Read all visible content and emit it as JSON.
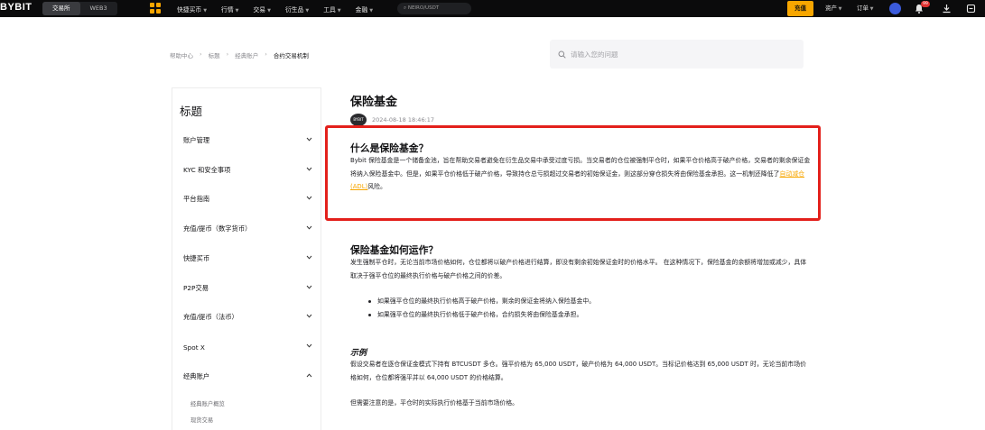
{
  "topnav": {
    "logo": "BYBIT",
    "seg_tabs": [
      "交易所",
      "WEB3"
    ],
    "menu": [
      "快捷买币",
      "行情",
      "交易",
      "衍生品",
      "工具",
      "金融"
    ],
    "search_placeholder": "NEIRO/USDT",
    "deposit_label": "充值",
    "assets_label": "资产",
    "orders_label": "订单",
    "notification_count": "99",
    "accent_color": "#f7a600"
  },
  "breadcrumb": [
    "帮助中心",
    "标题",
    "经典账户",
    "合约交易机制"
  ],
  "help_search": {
    "placeholder": "请输入您的问题"
  },
  "sidebar": {
    "title": "标题",
    "items": [
      {
        "label": "账户管理",
        "expanded": false
      },
      {
        "label": "KYC 和安全事项",
        "expanded": false
      },
      {
        "label": "平台指南",
        "expanded": false
      },
      {
        "label": "充值/提币（数字货币）",
        "expanded": false
      },
      {
        "label": "快捷买币",
        "expanded": false
      },
      {
        "label": "P2P交易",
        "expanded": false
      },
      {
        "label": "充值/提币（法币）",
        "expanded": false
      },
      {
        "label": "Spot X",
        "expanded": false
      },
      {
        "label": "经典账户",
        "expanded": true
      }
    ],
    "sub_items": [
      "经典账户概览",
      "现货交易"
    ]
  },
  "article": {
    "title": "保险基金",
    "author_badge": "BYBIT",
    "date": "2024-08-18 18:46:17",
    "section1": {
      "heading": "什么是保险基金？",
      "text_before_link": "Bybit 保险基金是一个储备金池，旨在帮助交易者避免在衍生品交易中承受过度亏损。当交易者的仓位被强制平仓时，如果平仓价格高于破产价格，交易者的剩余保证金将纳入保险基金中。但是，如果平仓价格低于破产价格，导致持仓总亏损超过交易者的初始保证金，则这部分穿仓损失将由保险基金承担。这一机制还降低了",
      "link_text": "自动减仓 (ADL)",
      "text_after_link": "风险。"
    },
    "section2": {
      "heading": "保险基金如何运作？",
      "text": "发生强制平仓时，无论当前市场价格如何，仓位都将以破产价格进行结算，即没有剩余初始保证金时的价格水平。 在这种情况下，保险基金的余额将增加或减少，具体取决于强平仓位的最终执行价格与破产价格之间的价差。",
      "bullets": [
        "如果强平仓位的最终执行价格高于破产价格，剩余的保证金将纳入保险基金中。",
        "如果强平仓位的最终执行价格低于破产价格，合约损失将由保险基金承担。"
      ]
    },
    "example": {
      "heading": "示例",
      "text": "假设交易者在逐仓保证金模式下持有 BTCUSDT 多仓。强平价格为 65,000 USDT，破产价格为 64,000 USDT。当标记价格达到 65,000 USDT 时，无论当前市场价格如何，仓位都将强平并以 64,000 USDT 的价格结算。",
      "note": "但需要注意的是，平仓时的实际执行价格基于当前市场价格。"
    }
  },
  "highlight_color": "#e3201b"
}
